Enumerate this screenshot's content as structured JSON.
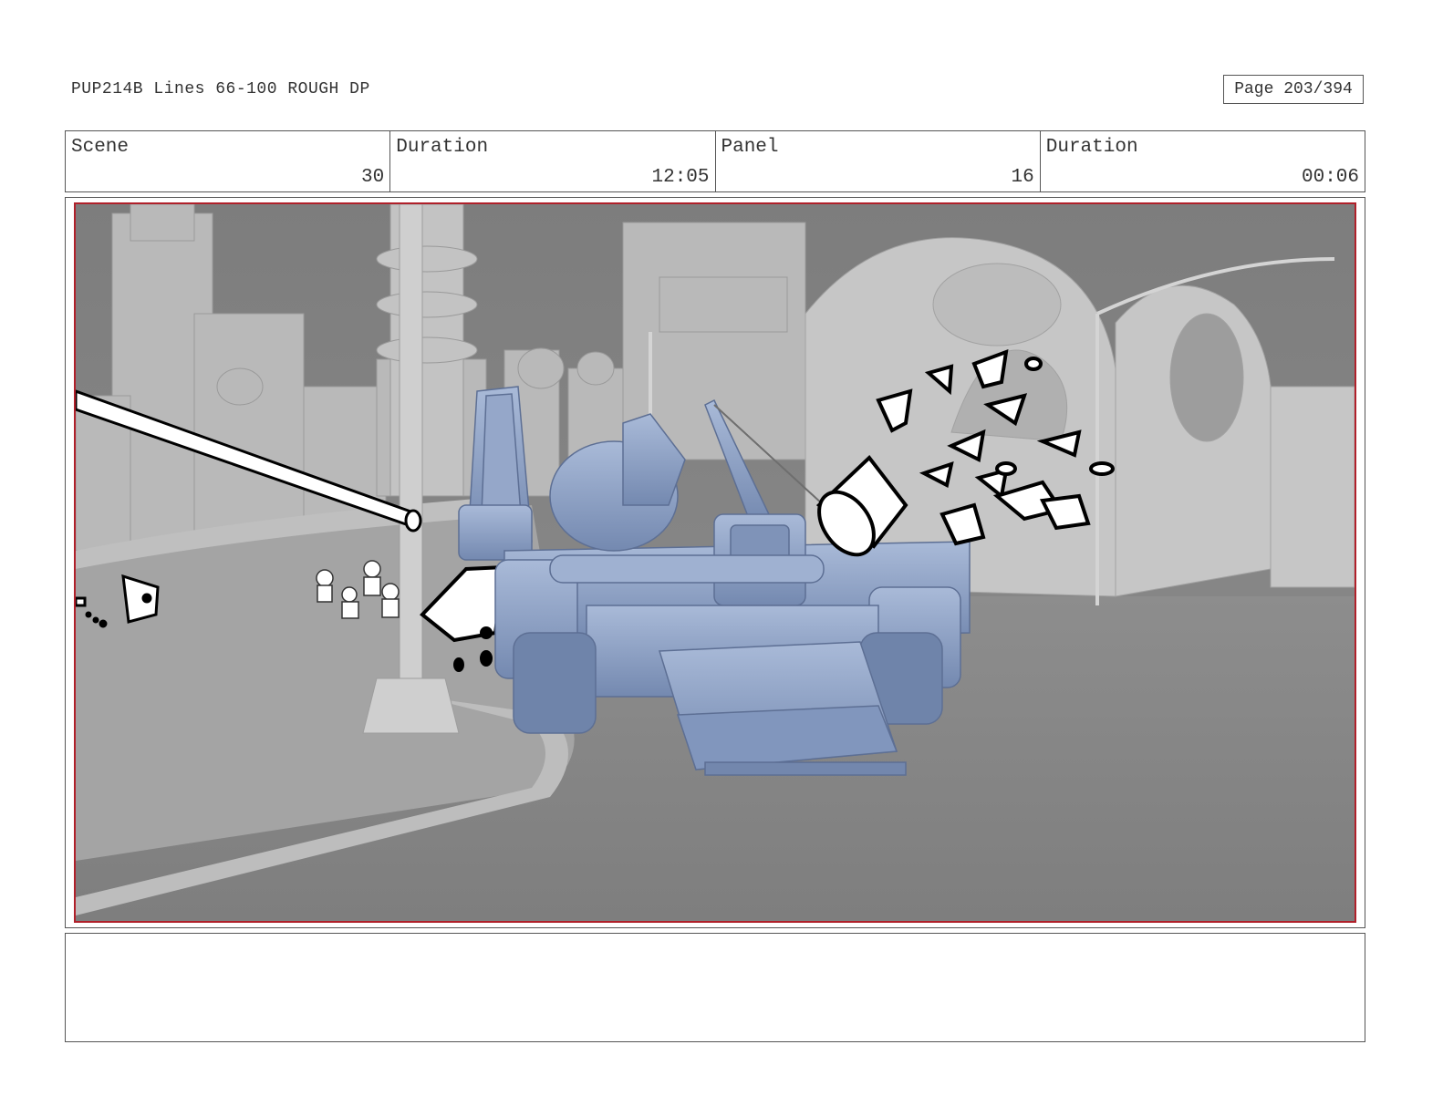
{
  "header": {
    "title": "PUP214B Lines 66-100 ROUGH DP",
    "page": "Page 203/394"
  },
  "info": {
    "scene_label": "Scene",
    "scene_value": "30",
    "duration_label": "Duration",
    "duration_value": "12:05",
    "panel_label": "Panel",
    "panel_value": "16",
    "panel_duration_label": "Duration",
    "panel_duration_value": "00:06"
  },
  "panel": {
    "colors": {
      "background": "#8a8a8a",
      "vehicle": "#8fa3c8",
      "frame": "#b0202a"
    }
  },
  "notes": {
    "text": ""
  }
}
